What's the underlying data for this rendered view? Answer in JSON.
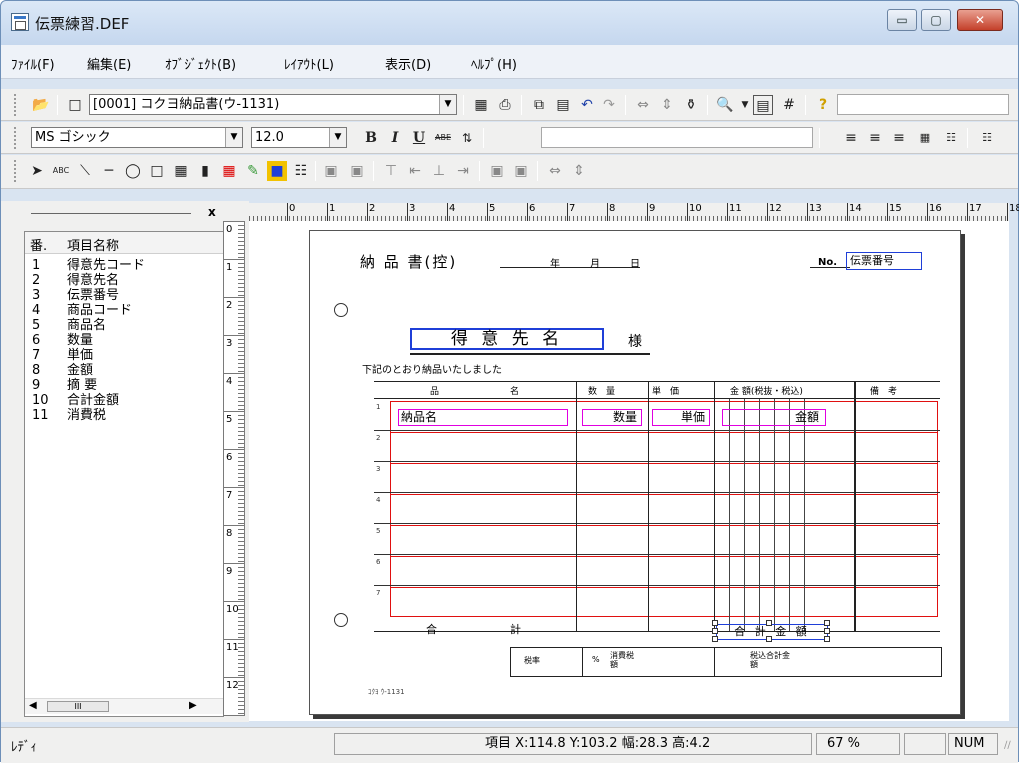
{
  "window": {
    "title": "伝票練習.DEF",
    "min_glyph": "▭",
    "max_glyph": "▢",
    "close_glyph": "✕"
  },
  "menu": [
    "ﾌｧｲﾙ(F)",
    "編集(E)",
    "ｵﾌﾞｼﾞｪｸﾄ(B)",
    "ﾚｲｱｳﾄ(L)",
    "表示(D)",
    "ﾍﾙﾌﾟ(H)"
  ],
  "toolbar1": {
    "form_select": "[0001] コクヨ納品書(ウ-1131)"
  },
  "toolbar2": {
    "font_select": "MS ゴシック",
    "size_select": "12.0",
    "bold": "B",
    "italic": "I",
    "underline": "U",
    "strike": "ABE"
  },
  "toolbar3": {
    "text_tool": "ABC"
  },
  "panel": {
    "close": "x",
    "header_num": "番.",
    "header_name": "項目名称",
    "scroll_label": "III"
  },
  "fields": [
    {
      "num": "1",
      "name": "得意先コード"
    },
    {
      "num": "2",
      "name": "得意先名"
    },
    {
      "num": "3",
      "name": "伝票番号"
    },
    {
      "num": "4",
      "name": "商品コード"
    },
    {
      "num": "5",
      "name": "商品名"
    },
    {
      "num": "6",
      "name": "数量"
    },
    {
      "num": "7",
      "name": "単価"
    },
    {
      "num": "8",
      "name": "金額"
    },
    {
      "num": "9",
      "name": "摘 要"
    },
    {
      "num": "10",
      "name": "合計金額"
    },
    {
      "num": "11",
      "name": "消費税"
    }
  ],
  "hruler": [
    "0",
    "1",
    "2",
    "3",
    "4",
    "5",
    "6",
    "7",
    "8",
    "9",
    "10",
    "11",
    "12",
    "13",
    "14",
    "15",
    "16",
    "17",
    "18"
  ],
  "vruler": [
    "0",
    "1",
    "2",
    "3",
    "4",
    "5",
    "6",
    "7",
    "8",
    "9",
    "10",
    "11",
    "12"
  ],
  "form": {
    "title": "納 品 書(控)",
    "date_nen": "年",
    "date_tsuki": "月",
    "date_hi": "日",
    "no_label": "No.",
    "no_field": "伝票番号",
    "customer_field": "得 意 先 名",
    "sama": "様",
    "notice": "下記のとおり納品いたしました",
    "col_hinmei_1": "品",
    "col_hinmei_2": "名",
    "col_suryo": "数　量",
    "col_tanka": "単　価",
    "col_kingaku": "金 額(税抜・税込)",
    "col_biko": "備　考",
    "item_field": "納品名",
    "qty_field": "数量",
    "price_field": "単価",
    "amount_field": "金額",
    "total_1": "合",
    "total_2": "計",
    "total_field": "合 計 金 額",
    "tax_label": "税率",
    "pct": "%",
    "tax_amount": "消費税額",
    "grand_total": "税込合計金額",
    "footer_code": "ｺｸﾖ ｳ-1131",
    "row_marks": [
      "1",
      "2",
      "3",
      "4",
      "5",
      "6",
      "7"
    ]
  },
  "status": {
    "ready": "ﾚﾃﾞｨ",
    "coords": "項目 X:114.8 Y:103.2 幅:28.3 高:4.2",
    "zoom": "67 %",
    "num": "NUM"
  }
}
